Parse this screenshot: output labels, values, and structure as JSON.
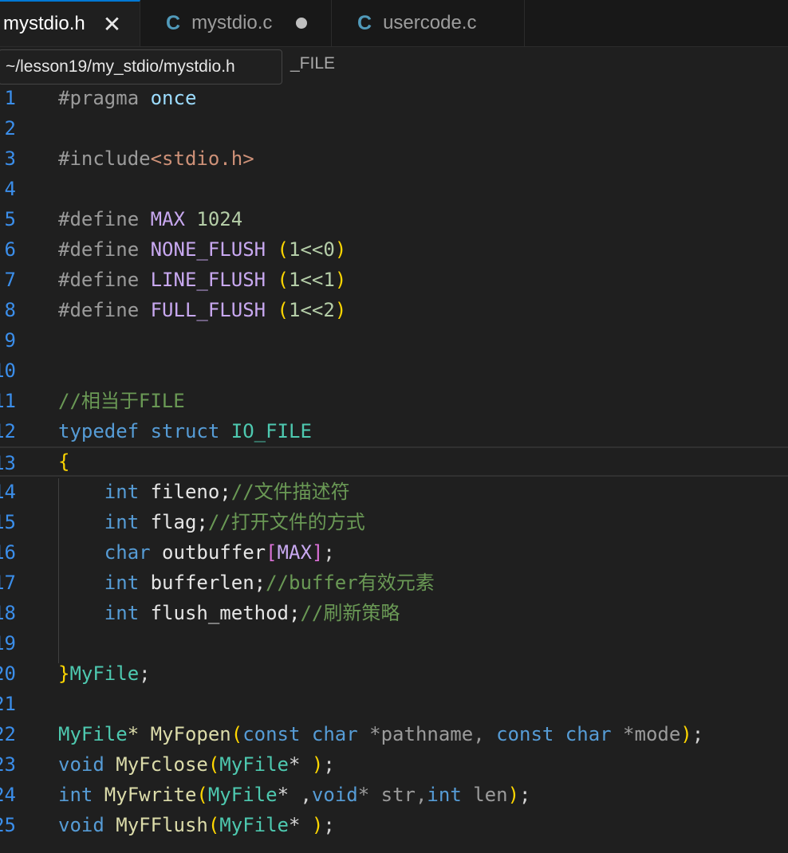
{
  "tabs": [
    {
      "label": "mystdio.h",
      "close": "✕",
      "state": "active"
    },
    {
      "icon": "C",
      "label": "mystdio.c",
      "state": "modified"
    },
    {
      "icon": "C",
      "label": "usercode.c",
      "state": "inactive"
    }
  ],
  "breadcrumb": "_FILE",
  "tooltip": "~/lesson19/my_stdio/mystdio.h",
  "code": {
    "line_numbers": [
      "1",
      "2",
      "3",
      "4",
      "5",
      "6",
      "7",
      "8",
      "9",
      "10",
      "11",
      "12",
      "13",
      "14",
      "15",
      "16",
      "17",
      "18",
      "19",
      "20",
      "21",
      "22",
      "23",
      "24",
      "25"
    ],
    "l1": {
      "a": "#pragma",
      "b": " once"
    },
    "l3": {
      "a": "#include",
      "b": "<",
      "c": "stdio.h",
      "d": ">"
    },
    "l5": {
      "a": "#define",
      "b": " MAX",
      "c": " 1024"
    },
    "l6": {
      "a": "#define",
      "b": " NONE_FLUSH",
      "c": " (",
      "d": "1<<0",
      "e": ")"
    },
    "l7": {
      "a": "#define",
      "b": " LINE_FLUSH",
      "c": " (",
      "d": "1<<1",
      "e": ")"
    },
    "l8": {
      "a": "#define",
      "b": " FULL_FLUSH",
      "c": " (",
      "d": "1<<2",
      "e": ")"
    },
    "l11": {
      "a": "//相当于FILE"
    },
    "l12": {
      "a": "typedef",
      "b": " struct",
      "c": " IO_FILE"
    },
    "l13": {
      "a": "{"
    },
    "l14": {
      "a": "    int",
      "b": " fileno;",
      "c": "//文件描述符"
    },
    "l15": {
      "a": "    int",
      "b": " flag;",
      "c": "//打开文件的方式"
    },
    "l16": {
      "a": "    char",
      "b": " outbuffer",
      "c": "[",
      "d": "MAX",
      "e": "]",
      "f": ";"
    },
    "l17": {
      "a": "    int",
      "b": " bufferlen;",
      "c": "//buffer有效元素"
    },
    "l18": {
      "a": "    int",
      "b": " flush_method;",
      "c": "//刷新策略"
    },
    "l20": {
      "a": "}",
      "b": "MyFile",
      "c": ";"
    },
    "l22": {
      "a": "MyFile",
      "b": "* MyFopen",
      "c": "(",
      "d": "const",
      "e": " char",
      "f": " *pathname, ",
      "g": "const",
      "h": " char",
      "i": " *mode",
      "j": ")",
      "k": ";"
    },
    "l23": {
      "a": "void",
      "b": " MyFclose",
      "c": "(",
      "d": "MyFile",
      "e": "* ",
      "f": ")",
      "g": ";"
    },
    "l24": {
      "a": "int",
      "b": " MyFwrite",
      "c": "(",
      "d": "MyFile",
      "e": "* ,",
      "f": "void",
      "g": "* str,",
      "h": "int",
      "i": " len",
      "j": ")",
      "k": ";"
    },
    "l25": {
      "a": "void",
      "b": " MyFFlush",
      "c": "(",
      "d": "MyFile",
      "e": "* ",
      "f": ")",
      "g": ";"
    }
  }
}
